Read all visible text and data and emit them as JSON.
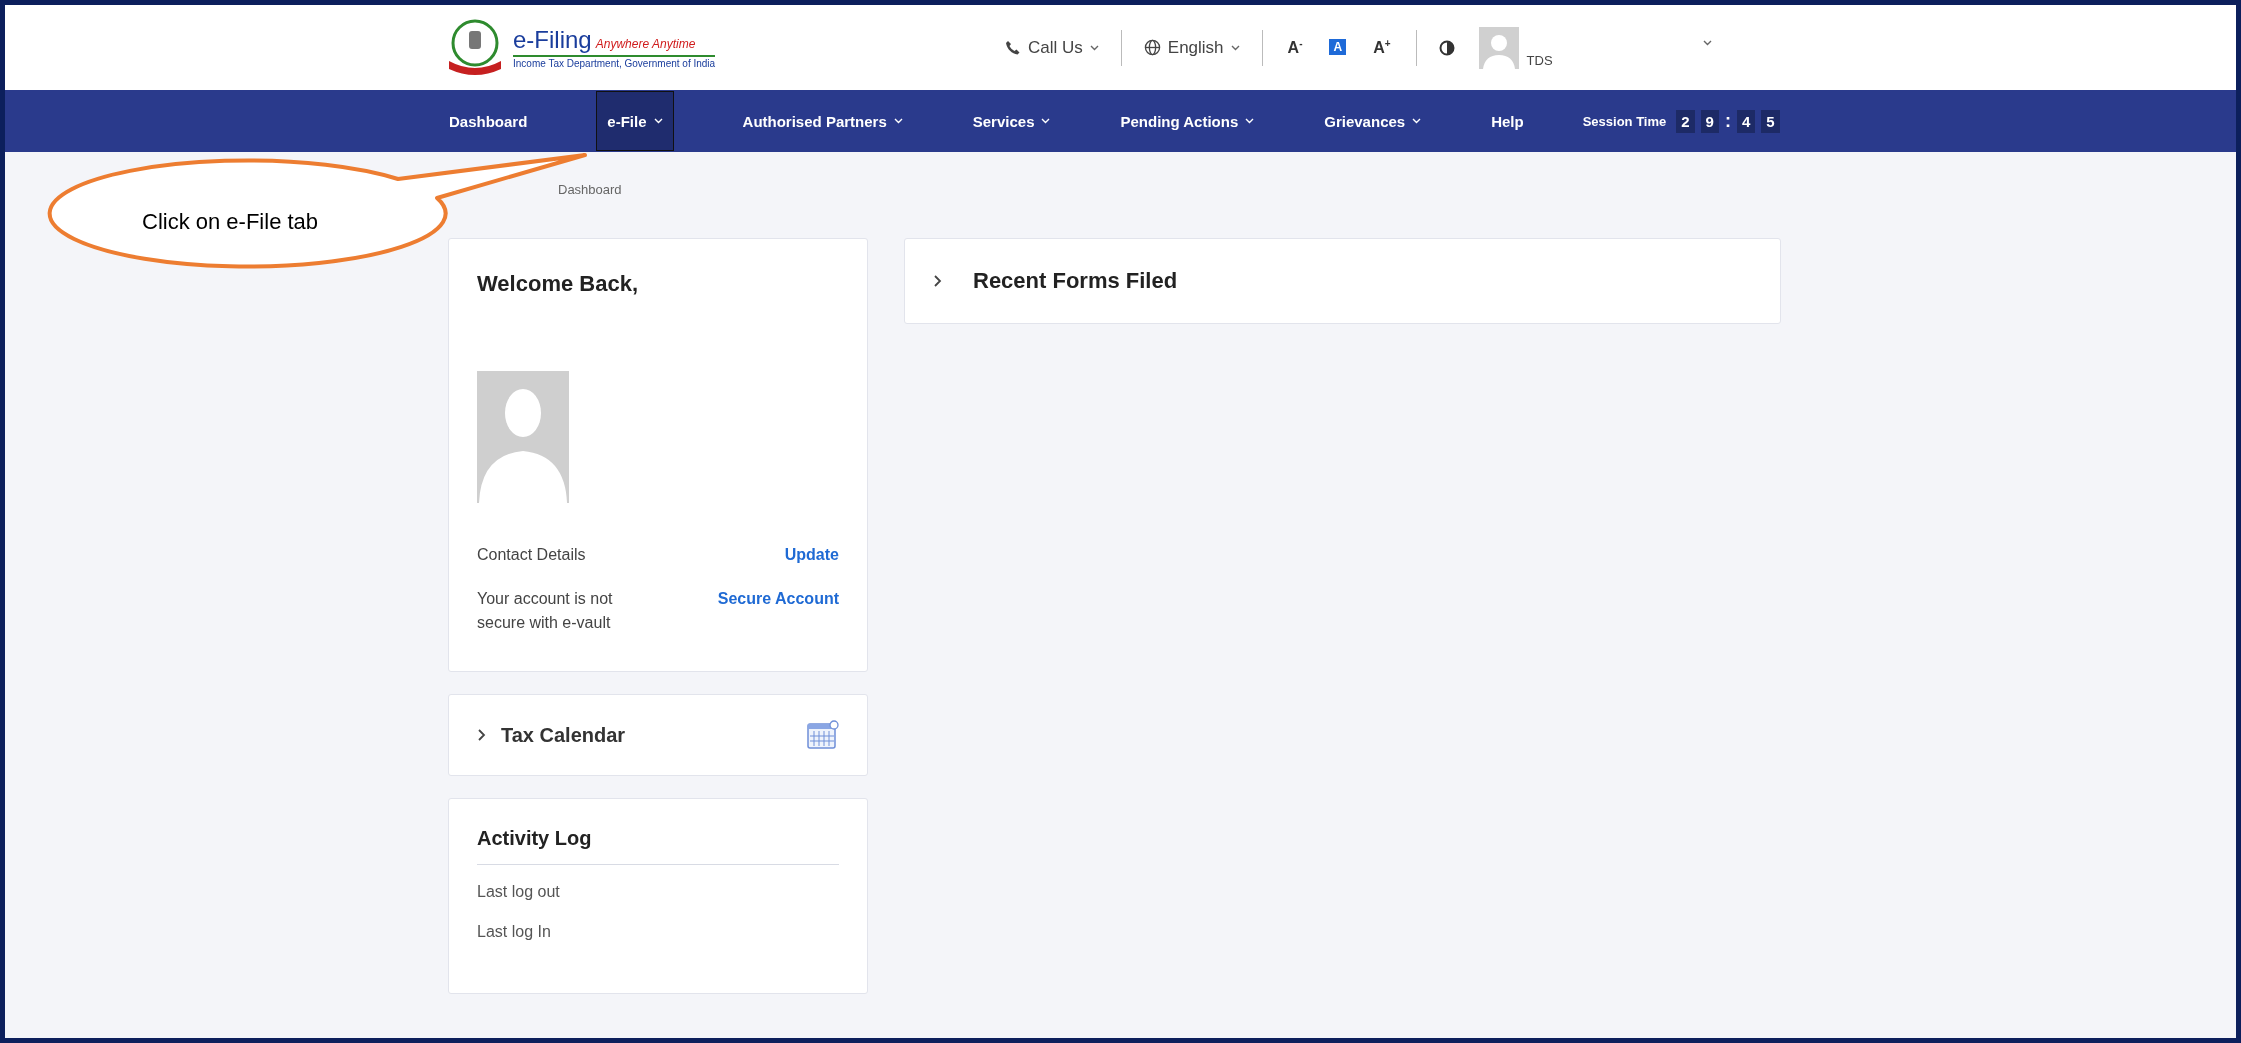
{
  "header": {
    "logo": {
      "title": "e-Filing",
      "tagline": "Anywhere Anytime",
      "subtitle": "Income Tax Department, Government of India"
    },
    "call_us": "Call Us",
    "language": "English",
    "font_controls": [
      {
        "label": "A$^{-}$",
        "selected": false
      },
      {
        "label": "A",
        "selected": true
      },
      {
        "label": "A$^{+}$",
        "selected": false
      }
    ],
    "user": {
      "role": "TDS"
    }
  },
  "nav": {
    "items": [
      {
        "label": "Dashboard",
        "dropdown": false,
        "selected": false
      },
      {
        "label": "e-File",
        "dropdown": true,
        "selected": true
      },
      {
        "label": "Authorised Partners",
        "dropdown": true,
        "selected": false
      },
      {
        "label": "Services",
        "dropdown": true,
        "selected": false
      },
      {
        "label": "Pending Actions",
        "dropdown": true,
        "selected": false
      },
      {
        "label": "Grievances",
        "dropdown": true,
        "selected": false
      },
      {
        "label": "Help",
        "dropdown": false,
        "selected": false
      }
    ],
    "session": {
      "label": "Session Time",
      "digits": [
        "2",
        "9",
        ":",
        "4",
        "5"
      ]
    }
  },
  "breadcrumb": "Dashboard",
  "profile_card": {
    "heading": "Welcome Back,",
    "rows": [
      {
        "label": "Contact Details",
        "action": "Update"
      },
      {
        "label": "Your account is not secure with e-vault",
        "action": "Secure Account"
      }
    ]
  },
  "tax_calendar": {
    "title": "Tax Calendar",
    "expanded": false
  },
  "activity_log": {
    "title": "Activity Log",
    "items": [
      "Last log out",
      "Last log In"
    ]
  },
  "recent_forms": {
    "title": "Recent Forms Filed",
    "expanded": false
  },
  "callout": {
    "text": "Click on e-File tab"
  }
}
